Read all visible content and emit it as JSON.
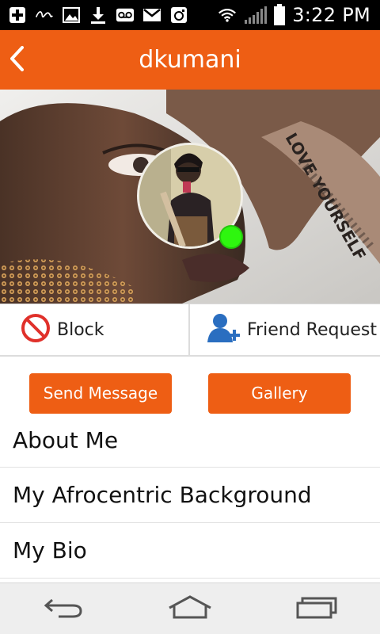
{
  "status_bar": {
    "time": "3:22 PM",
    "icons": [
      "plus-icon",
      "virgin-logo-icon",
      "image-icon",
      "download-icon",
      "voicemail-icon",
      "mail-icon",
      "instagram-icon",
      "wifi-icon",
      "signal-icon",
      "battery-icon"
    ]
  },
  "app_bar": {
    "title": "dkumani",
    "back_icon": "chevron-left-icon"
  },
  "profile": {
    "online": true,
    "online_color": "#2ef60f",
    "cover_text": "LOVE YOURSELF"
  },
  "actions": {
    "block_label": "Block",
    "block_icon": "block-icon",
    "friend_request_label": "Friend Request",
    "friend_request_icon": "add-user-icon"
  },
  "buttons": {
    "send_message": "Send Message",
    "gallery": "Gallery"
  },
  "sections": [
    {
      "label": "About Me"
    },
    {
      "label": "My Afrocentric Background"
    },
    {
      "label": "My Bio"
    }
  ],
  "nav_bar": {
    "icons": [
      "back-nav-icon",
      "home-nav-icon",
      "recents-nav-icon"
    ]
  },
  "colors": {
    "accent": "#ee5e14",
    "status_bar": "#000000",
    "nav_bar": "#eeeeee"
  }
}
